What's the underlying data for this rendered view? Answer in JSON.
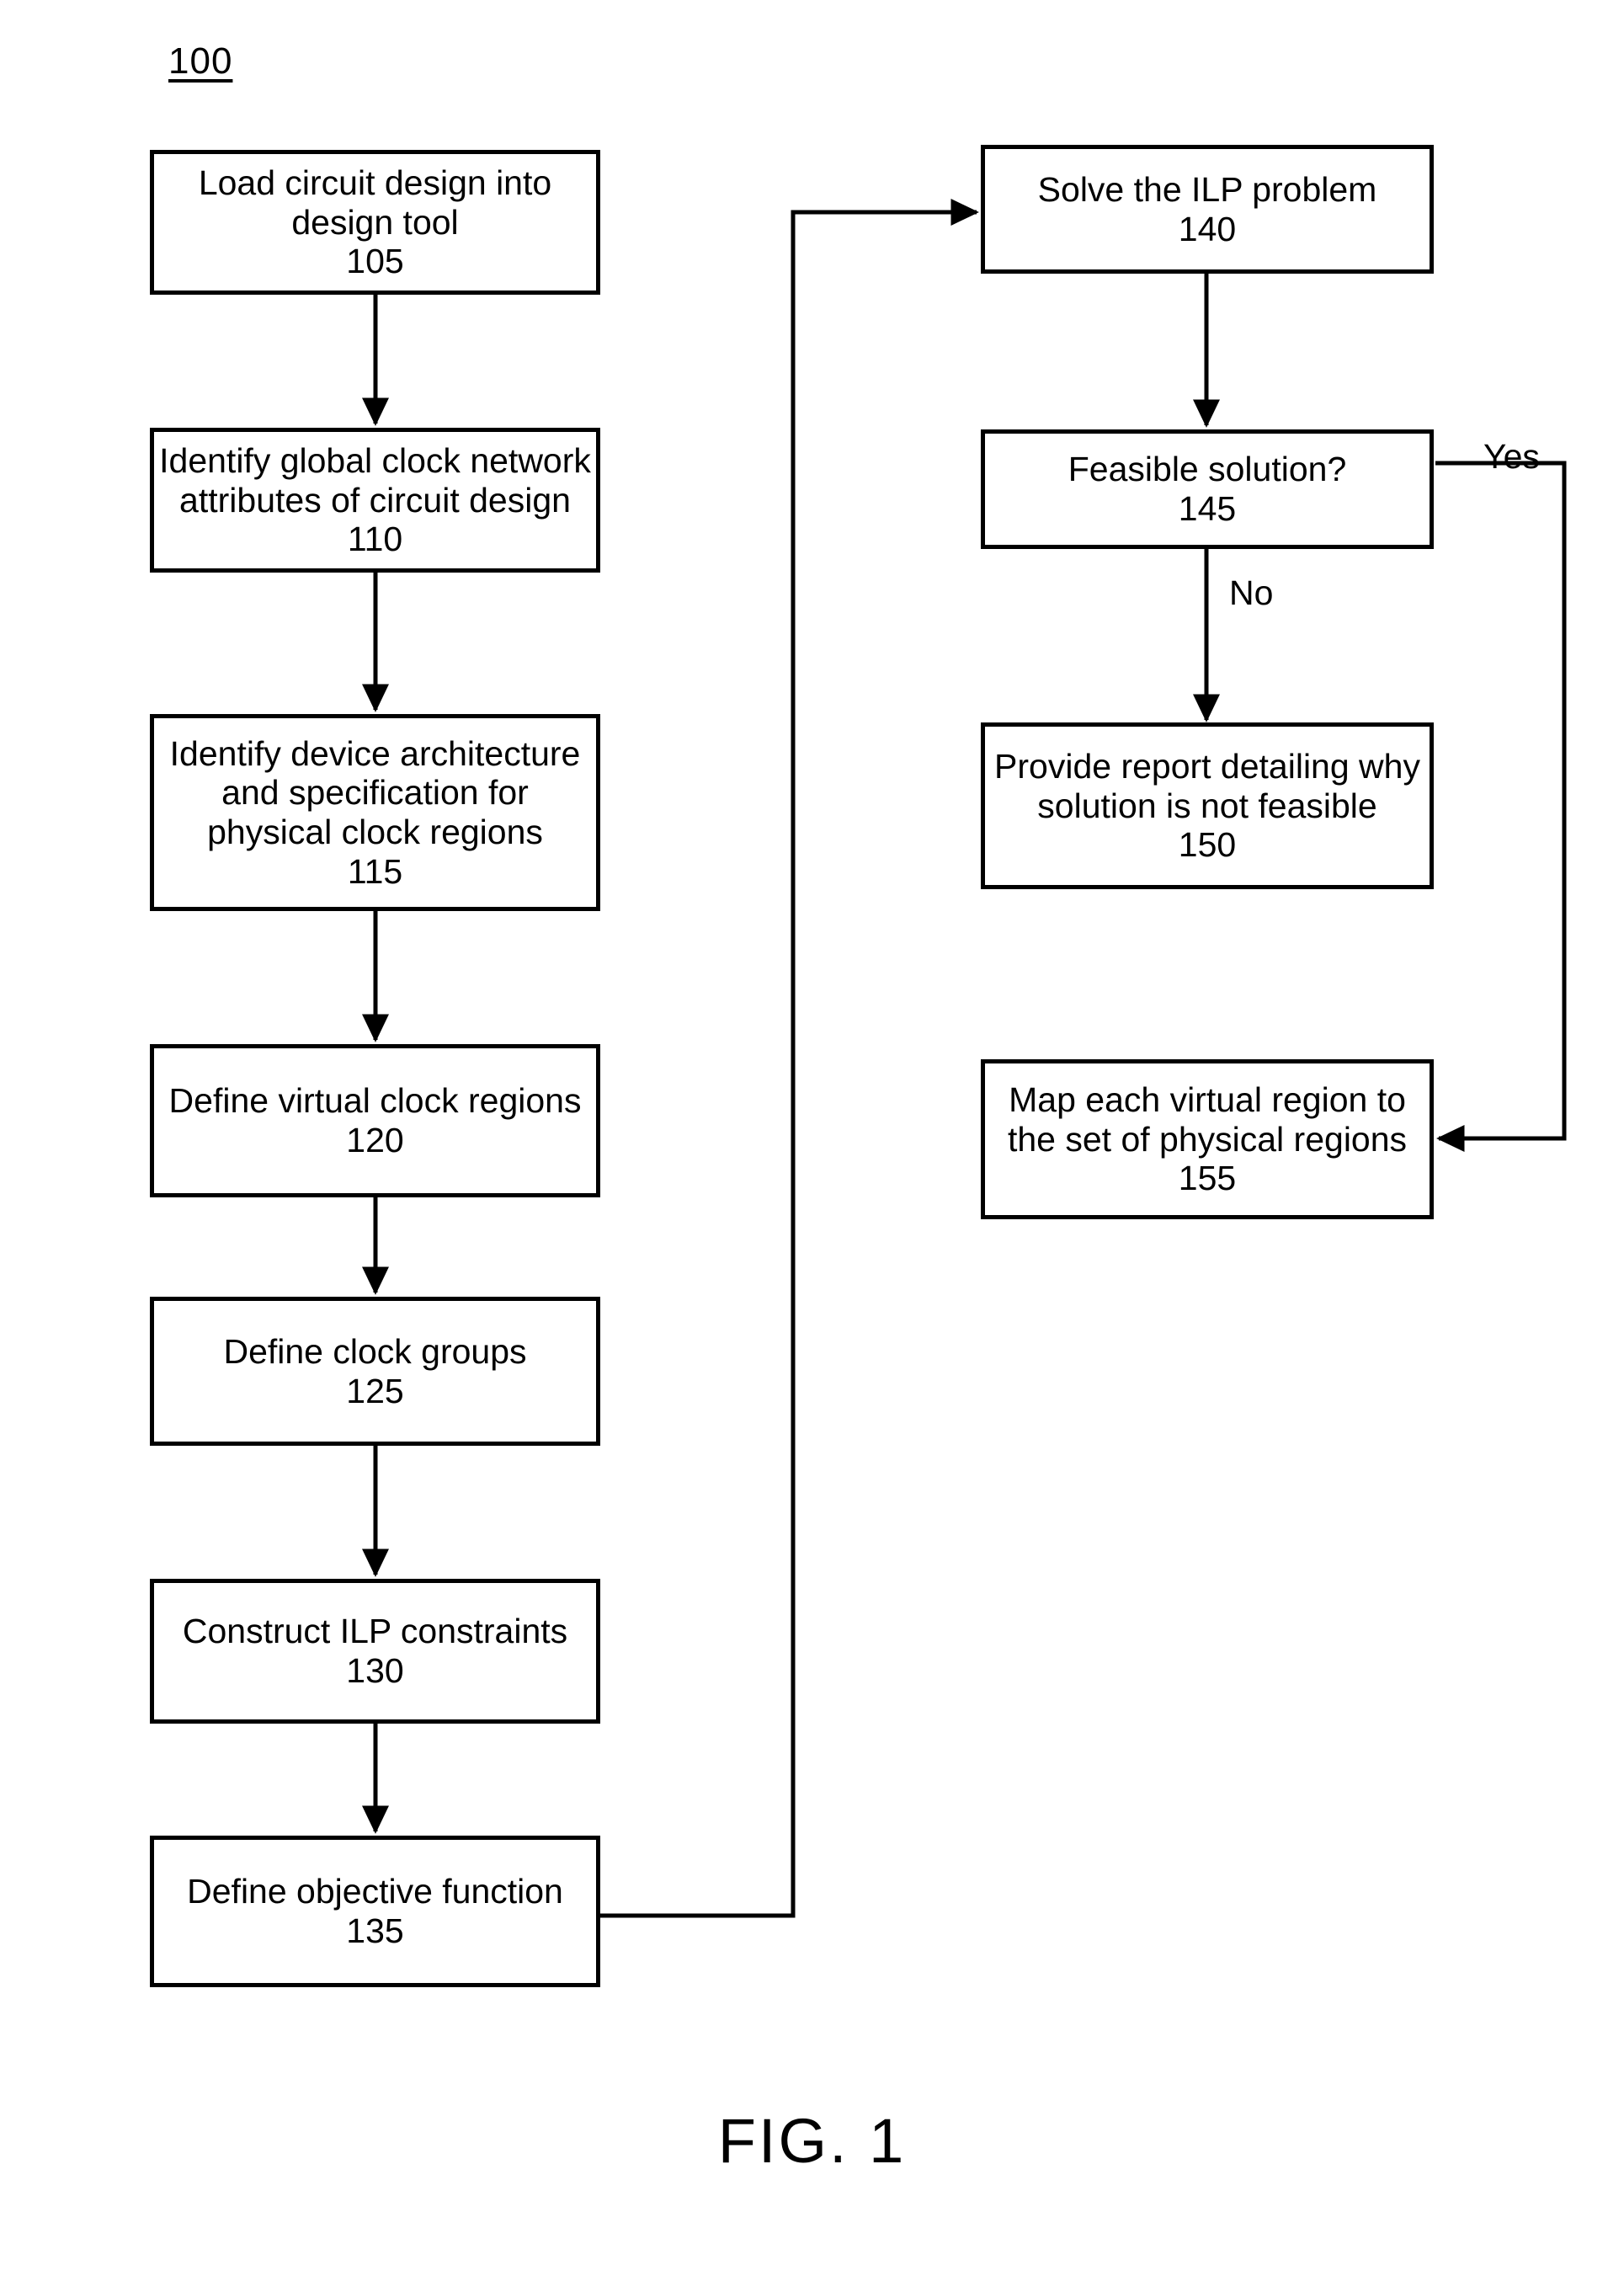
{
  "figure": {
    "reference_numeral": "100",
    "caption": "FIG. 1"
  },
  "diagram_data": {
    "type": "flowchart",
    "orientation": "two-column, left column top-to-bottom then right column top-to-bottom",
    "nodes": [
      {
        "id": "105",
        "text": "Load circuit design into\ndesign tool",
        "number": "105",
        "column": "left"
      },
      {
        "id": "110",
        "text": "Identify global clock network\nattributes of circuit design",
        "number": "110",
        "column": "left"
      },
      {
        "id": "115",
        "text": "Identify device architecture\nand specification for\nphysical clock regions",
        "number": "115",
        "column": "left"
      },
      {
        "id": "120",
        "text": "Define virtual clock regions",
        "number": "120",
        "column": "left"
      },
      {
        "id": "125",
        "text": "Define clock groups",
        "number": "125",
        "column": "left"
      },
      {
        "id": "130",
        "text": "Construct ILP constraints",
        "number": "130",
        "column": "left"
      },
      {
        "id": "135",
        "text": "Define objective function",
        "number": "135",
        "column": "left"
      },
      {
        "id": "140",
        "text": "Solve the ILP problem",
        "number": "140",
        "column": "right"
      },
      {
        "id": "145",
        "text": "Feasible solution?",
        "number": "145",
        "column": "right"
      },
      {
        "id": "150",
        "text": "Provide report detailing why\nsolution is not feasible",
        "number": "150",
        "column": "right"
      },
      {
        "id": "155",
        "text": "Map each virtual region to\nthe set of physical regions",
        "number": "155",
        "column": "right"
      }
    ],
    "edges": [
      {
        "from": "105",
        "to": "110",
        "label": ""
      },
      {
        "from": "110",
        "to": "115",
        "label": ""
      },
      {
        "from": "115",
        "to": "120",
        "label": ""
      },
      {
        "from": "120",
        "to": "125",
        "label": ""
      },
      {
        "from": "125",
        "to": "130",
        "label": ""
      },
      {
        "from": "130",
        "to": "135",
        "label": ""
      },
      {
        "from": "135",
        "to": "140",
        "label": ""
      },
      {
        "from": "140",
        "to": "145",
        "label": ""
      },
      {
        "from": "145",
        "to": "150",
        "label": "No"
      },
      {
        "from": "145",
        "to": "155",
        "label": "Yes"
      }
    ],
    "edge_labels": {
      "yes": "Yes",
      "no": "No"
    },
    "colors": {
      "stroke": "#000000",
      "fill": "#ffffff",
      "text": "#000000"
    }
  }
}
